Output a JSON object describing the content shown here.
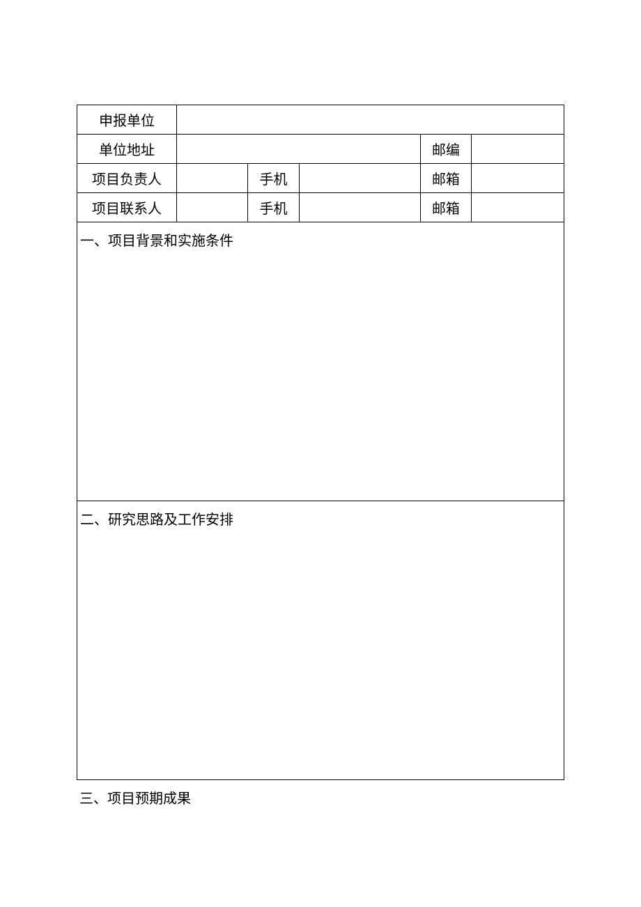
{
  "rows": {
    "applicant_unit_label": "申报单位",
    "applicant_unit_value": "",
    "unit_address_label": "单位地址",
    "unit_address_value": "",
    "postcode_label": "邮编",
    "postcode_value": "",
    "project_leader_label": "项目负责人",
    "project_leader_value": "",
    "leader_phone_label": "手机",
    "leader_phone_value": "",
    "leader_email_label": "邮箱",
    "leader_email_value": "",
    "project_contact_label": "项目联系人",
    "project_contact_value": "",
    "contact_phone_label": "手机",
    "contact_phone_value": "",
    "contact_email_label": "邮箱",
    "contact_email_value": ""
  },
  "sections": {
    "section1_title": "一、项目背景和实施条件",
    "section1_content": "",
    "section2_title": "二、研究思路及工作安排",
    "section2_content": "",
    "section3_title": "三、项目预期成果",
    "section3_content": ""
  }
}
